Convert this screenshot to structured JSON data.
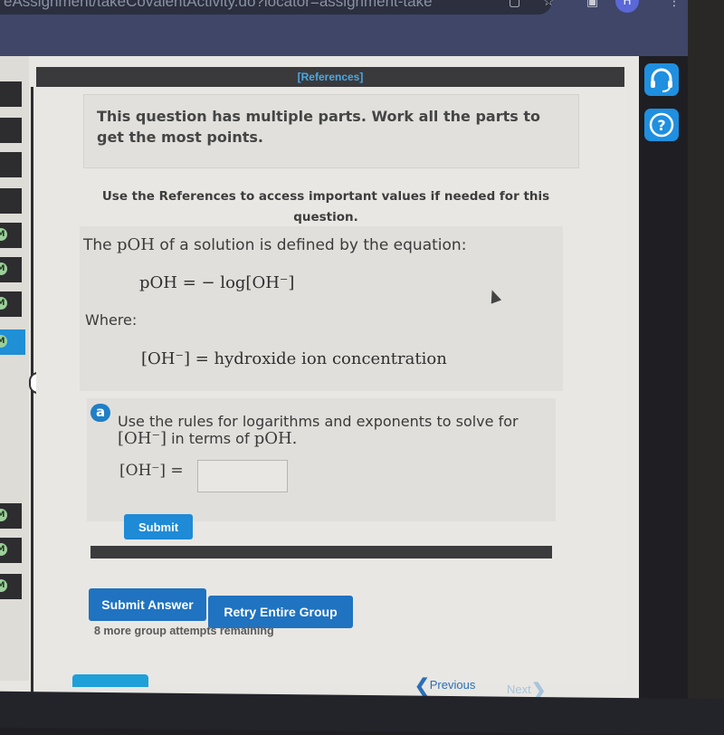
{
  "browser": {
    "url": "eAssignment/takeCovalentActivity.do?locator=assignment-take",
    "avatar_initial": "H",
    "icons": [
      "copy-icon",
      "star-icon",
      "extension-icon",
      "menu-dots-icon"
    ]
  },
  "references_link": "[References]",
  "intro": "This question has multiple parts. Work all the parts to get the most points.",
  "references_note": "Use the References to access important values if needed for this question.",
  "definition": {
    "lead_pre": "The ",
    "lead_math": "pOH",
    "lead_post": " of a solution is defined by the equation:",
    "equation": "pOH = − log[OH⁻]",
    "where_label": "Where:",
    "where_equation": "[OH⁻] = hydroxide ion concentration"
  },
  "part_a": {
    "badge": "a",
    "prompt_line1": "Use the rules for logarithms and exponents to solve for",
    "prompt_math1": "[OH⁻]",
    "prompt_mid": " in terms of ",
    "prompt_math2": "pOH.",
    "answer_label": "[OH⁻] =",
    "answer_value": "",
    "submit_label": "Submit"
  },
  "actions": {
    "submit_answer": "Submit Answer",
    "retry_group": "Retry Entire Group",
    "attempts_remaining": "8 more group attempts remaining"
  },
  "navigation": {
    "previous": "Previous",
    "next": "Next"
  },
  "sidebar": {
    "items": [
      {
        "state": "default",
        "badge": ""
      },
      {
        "state": "default",
        "badge": ""
      },
      {
        "state": "default",
        "badge": ""
      },
      {
        "state": "default",
        "badge": ""
      },
      {
        "state": "default",
        "badge": "M"
      },
      {
        "state": "default",
        "badge": "M"
      },
      {
        "state": "default",
        "badge": "M"
      },
      {
        "state": "active",
        "badge": "M"
      },
      {
        "state": "default",
        "badge": "M"
      },
      {
        "state": "default",
        "badge": "M"
      },
      {
        "state": "default",
        "badge": "M"
      }
    ],
    "collapse_glyph": "<"
  },
  "tools": {
    "support_icon": "headset-icon",
    "help_glyph": "?"
  },
  "colors": {
    "accent": "#1f73c0",
    "references_link": "#4aa8e4",
    "active_sidebar": "#1f8fd6"
  }
}
